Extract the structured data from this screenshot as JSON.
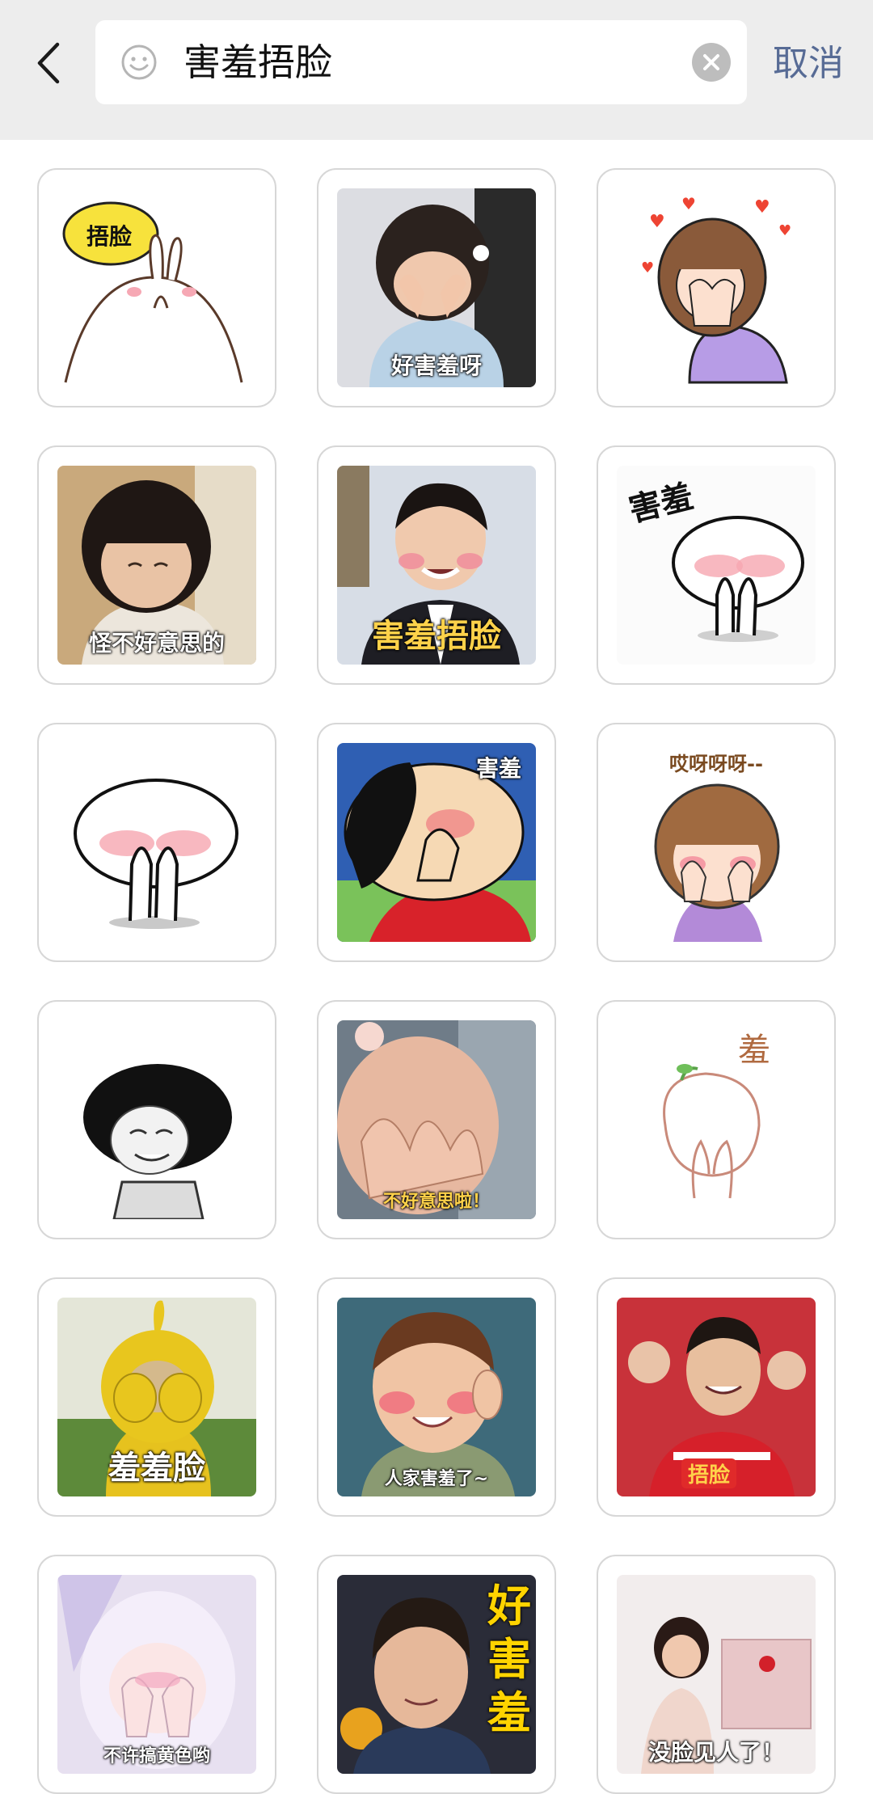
{
  "search": {
    "query": "害羞捂脸",
    "cancel_label": "取消"
  },
  "icons": {
    "back": "chevron-left-icon",
    "emoji": "smile-icon",
    "clear": "clear-icon"
  },
  "colors": {
    "header_bg": "#ededed",
    "cancel": "#576b95",
    "tile_border": "#d7d7d7"
  },
  "stickers": [
    {
      "caption": "捂脸"
    },
    {
      "caption": "好害羞呀"
    },
    {
      "caption": ""
    },
    {
      "caption": "怪不好意思的"
    },
    {
      "caption": "害羞捂脸"
    },
    {
      "caption": "害羞"
    },
    {
      "caption": ""
    },
    {
      "caption": "害羞"
    },
    {
      "caption": "哎呀呀呀--"
    },
    {
      "caption": ""
    },
    {
      "caption": "不好意思啦！"
    },
    {
      "caption": "羞"
    },
    {
      "caption": "羞羞脸"
    },
    {
      "caption": "人家害羞了~"
    },
    {
      "caption": "捂脸"
    },
    {
      "caption": "不许搞黄色哟"
    },
    {
      "caption": "好害羞"
    },
    {
      "caption": "没脸见人了！"
    }
  ]
}
